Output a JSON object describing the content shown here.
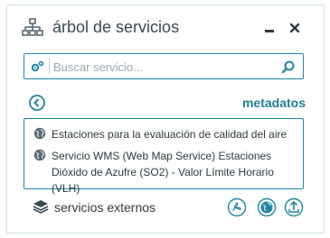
{
  "panel": {
    "title": "árbol de servicios",
    "icons": {
      "title": "sitemap-icon",
      "minimize": "minimize-icon",
      "close": "close-icon"
    }
  },
  "search": {
    "placeholder": "Buscar servicio...",
    "icons": {
      "left": "gear-icon",
      "right": "search-icon"
    }
  },
  "nav": {
    "back_icon": "back-arrow-icon",
    "metadata_label": "metadatos"
  },
  "services": {
    "items": [
      {
        "icon": "globe-icon",
        "label": "Estaciones para la evaluación de calidad del aire"
      },
      {
        "icon": "globe-icon",
        "label": "Servicio WMS (Web Map Service) Estaciones Dióxido de Azufre (SO2) - Valor Límite Horario (VLH)"
      }
    ]
  },
  "footer": {
    "external_label": "servicios externos",
    "icons": [
      "pdf-icon",
      "globe-icon",
      "upload-icon"
    ]
  },
  "colors": {
    "accent": "#1f86a3",
    "icon_gray": "#5a6a72",
    "text": "#2d3a40"
  }
}
